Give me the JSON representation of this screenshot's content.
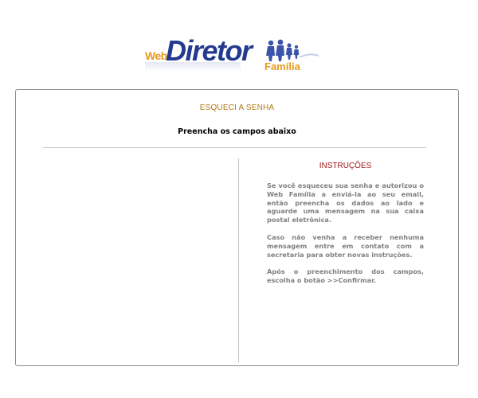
{
  "logo": {
    "web": "Web",
    "diretor": "Diretor",
    "familia": "Família",
    "icon": "people-group-icon"
  },
  "panel": {
    "title": "ESQUECI A SENHA",
    "subtitle": "Preencha os campos abaixo"
  },
  "instructions": {
    "title": "INSTRUÇÕES",
    "paragraphs": [
      "Se você esqueceu sua senha e autorizou o Web Família a enviá-la  ao seu email, então preencha os dados ao lado e aguarde uma mensagem na sua caixa postal eletrônica.",
      "Caso não venha a receber nenhuma mensagem entre em contato com a secretaria para obter novas instruções.",
      "Após o preenchimento dos campos, escolha o botão >>Confirmar."
    ]
  },
  "colors": {
    "logo_blue": "#243a8e",
    "logo_orange": "#e69a1c",
    "title_gold": "#b07a10",
    "instructions_red": "#a01818",
    "body_gray": "#808080"
  }
}
